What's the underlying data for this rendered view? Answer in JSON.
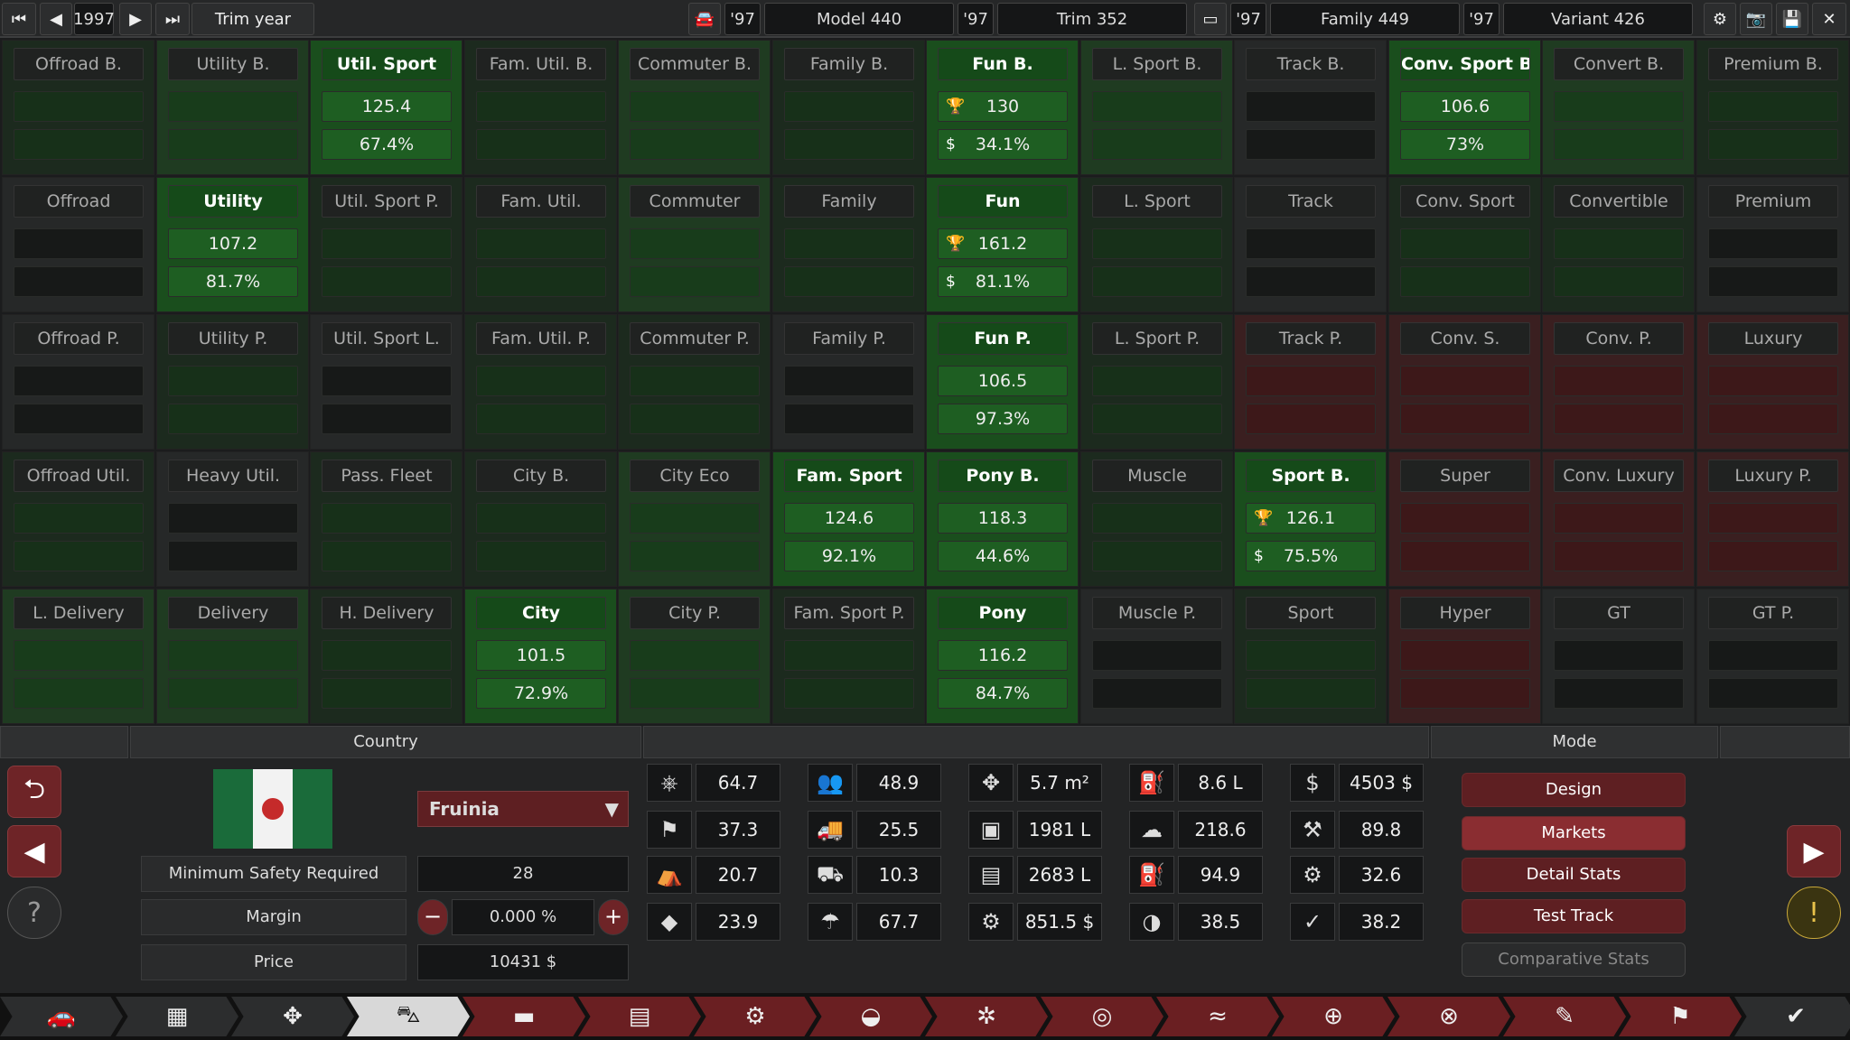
{
  "topbar": {
    "year": "1997",
    "trim_year_label": "Trim year",
    "model_year": "'97",
    "model_label": "Model 440",
    "trim_year": "'97",
    "trim_label": "Trim 352",
    "family_year": "'97",
    "family_label": "Family 449",
    "variant_year": "'97",
    "variant_label": "Variant 426"
  },
  "market_grid": [
    [
      {
        "label": "Offroad B.",
        "v1": "",
        "v2": "",
        "tone": "g0"
      },
      {
        "label": "Utility B.",
        "v1": "",
        "v2": "",
        "tone": "g1"
      },
      {
        "label": "Util. Sport",
        "v1": "125.4",
        "v2": "67.4%",
        "tone": "g2"
      },
      {
        "label": "Fam. Util. B.",
        "v1": "",
        "v2": "",
        "tone": "g0"
      },
      {
        "label": "Commuter B.",
        "v1": "",
        "v2": "",
        "tone": "g1"
      },
      {
        "label": "Family B.",
        "v1": "",
        "v2": "",
        "tone": "g0"
      },
      {
        "label": "Fun B.",
        "v1": "130",
        "v2": "34.1%",
        "tone": "g2",
        "icons": true
      },
      {
        "label": "L. Sport B.",
        "v1": "",
        "v2": "",
        "tone": "g1"
      },
      {
        "label": "Track B.",
        "v1": "",
        "v2": "",
        "tone": "n"
      },
      {
        "label": "Conv. Sport B.",
        "v1": "106.6",
        "v2": "73%",
        "tone": "g2"
      },
      {
        "label": "Convert B.",
        "v1": "",
        "v2": "",
        "tone": "g1"
      },
      {
        "label": "Premium B.",
        "v1": "",
        "v2": "",
        "tone": "g0"
      }
    ],
    [
      {
        "label": "Offroad",
        "v1": "",
        "v2": "",
        "tone": "n"
      },
      {
        "label": "Utility",
        "v1": "107.2",
        "v2": "81.7%",
        "tone": "g2"
      },
      {
        "label": "Util. Sport P.",
        "v1": "",
        "v2": "",
        "tone": "g0"
      },
      {
        "label": "Fam. Util.",
        "v1": "",
        "v2": "",
        "tone": "g0"
      },
      {
        "label": "Commuter",
        "v1": "",
        "v2": "",
        "tone": "g1"
      },
      {
        "label": "Family",
        "v1": "",
        "v2": "",
        "tone": "g0"
      },
      {
        "label": "Fun",
        "v1": "161.2",
        "v2": "81.1%",
        "tone": "g2",
        "icons": true
      },
      {
        "label": "L. Sport",
        "v1": "",
        "v2": "",
        "tone": "g0"
      },
      {
        "label": "Track",
        "v1": "",
        "v2": "",
        "tone": "n"
      },
      {
        "label": "Conv. Sport",
        "v1": "",
        "v2": "",
        "tone": "g0"
      },
      {
        "label": "Convertible",
        "v1": "",
        "v2": "",
        "tone": "g0"
      },
      {
        "label": "Premium",
        "v1": "",
        "v2": "",
        "tone": "n"
      }
    ],
    [
      {
        "label": "Offroad P.",
        "v1": "",
        "v2": "",
        "tone": "n"
      },
      {
        "label": "Utility P.",
        "v1": "",
        "v2": "",
        "tone": "g0"
      },
      {
        "label": "Util. Sport L.",
        "v1": "",
        "v2": "",
        "tone": "n"
      },
      {
        "label": "Fam. Util. P.",
        "v1": "",
        "v2": "",
        "tone": "g0"
      },
      {
        "label": "Commuter P.",
        "v1": "",
        "v2": "",
        "tone": "g0"
      },
      {
        "label": "Family P.",
        "v1": "",
        "v2": "",
        "tone": "n"
      },
      {
        "label": "Fun P.",
        "v1": "106.5",
        "v2": "97.3%",
        "tone": "g2"
      },
      {
        "label": "L. Sport P.",
        "v1": "",
        "v2": "",
        "tone": "g0"
      },
      {
        "label": "Track P.",
        "v1": "",
        "v2": "",
        "tone": "r1"
      },
      {
        "label": "Conv. S.",
        "v1": "",
        "v2": "",
        "tone": "r1"
      },
      {
        "label": "Conv. P.",
        "v1": "",
        "v2": "",
        "tone": "r1"
      },
      {
        "label": "Luxury",
        "v1": "",
        "v2": "",
        "tone": "r1"
      }
    ],
    [
      {
        "label": "Offroad Util.",
        "v1": "",
        "v2": "",
        "tone": "g0"
      },
      {
        "label": "Heavy Util.",
        "v1": "",
        "v2": "",
        "tone": "n"
      },
      {
        "label": "Pass. Fleet",
        "v1": "",
        "v2": "",
        "tone": "g0"
      },
      {
        "label": "City B.",
        "v1": "",
        "v2": "",
        "tone": "g0"
      },
      {
        "label": "City Eco",
        "v1": "",
        "v2": "",
        "tone": "g1"
      },
      {
        "label": "Fam. Sport",
        "v1": "124.6",
        "v2": "92.1%",
        "tone": "g2"
      },
      {
        "label": "Pony B.",
        "v1": "118.3",
        "v2": "44.6%",
        "tone": "g2"
      },
      {
        "label": "Muscle",
        "v1": "",
        "v2": "",
        "tone": "g0"
      },
      {
        "label": "Sport B.",
        "v1": "126.1",
        "v2": "75.5%",
        "tone": "g2",
        "icons": true
      },
      {
        "label": "Super",
        "v1": "",
        "v2": "",
        "tone": "r1"
      },
      {
        "label": "Conv. Luxury",
        "v1": "",
        "v2": "",
        "tone": "r1"
      },
      {
        "label": "Luxury P.",
        "v1": "",
        "v2": "",
        "tone": "r1"
      }
    ],
    [
      {
        "label": "L. Delivery",
        "v1": "",
        "v2": "",
        "tone": "g1"
      },
      {
        "label": "Delivery",
        "v1": "",
        "v2": "",
        "tone": "g1"
      },
      {
        "label": "H. Delivery",
        "v1": "",
        "v2": "",
        "tone": "g0"
      },
      {
        "label": "City",
        "v1": "101.5",
        "v2": "72.9%",
        "tone": "g2"
      },
      {
        "label": "City P.",
        "v1": "",
        "v2": "",
        "tone": "g1"
      },
      {
        "label": "Fam. Sport P.",
        "v1": "",
        "v2": "",
        "tone": "g0"
      },
      {
        "label": "Pony",
        "v1": "116.2",
        "v2": "84.7%",
        "tone": "g2"
      },
      {
        "label": "Muscle P.",
        "v1": "",
        "v2": "",
        "tone": "n"
      },
      {
        "label": "Sport",
        "v1": "",
        "v2": "",
        "tone": "g0"
      },
      {
        "label": "Hyper",
        "v1": "",
        "v2": "",
        "tone": "r1"
      },
      {
        "label": "GT",
        "v1": "",
        "v2": "",
        "tone": "n"
      },
      {
        "label": "GT P.",
        "v1": "",
        "v2": "",
        "tone": "n"
      }
    ]
  ],
  "country": {
    "header": "Country",
    "selected": "Fruinia",
    "min_safety_label": "Minimum Safety Required",
    "min_safety_value": "28",
    "margin_label": "Margin",
    "margin_value": "0.000 %",
    "price_label": "Price",
    "price_value": "10431 $"
  },
  "stats": [
    {
      "icon": "steering-wheel-icon",
      "glyph": "⎈",
      "value": "64.7"
    },
    {
      "icon": "passengers-icon",
      "glyph": "👥",
      "value": "48.9"
    },
    {
      "icon": "dimensions-icon",
      "glyph": "✥",
      "value": "5.7 m²"
    },
    {
      "icon": "fuel-tank-icon",
      "glyph": "⛽",
      "value": "8.6 L"
    },
    {
      "icon": "cost-icon",
      "glyph": "$",
      "value": "4503 $"
    },
    {
      "icon": "race-flag-icon",
      "glyph": "⚑",
      "value": "37.3"
    },
    {
      "icon": "utility-vehicle-icon",
      "glyph": "🚚",
      "value": "25.5"
    },
    {
      "icon": "cargo-volume-icon",
      "glyph": "▣",
      "value": "1981 L"
    },
    {
      "icon": "emissions-icon",
      "glyph": "☁",
      "value": "218.6"
    },
    {
      "icon": "workload-icon",
      "glyph": "⚒",
      "value": "89.8"
    },
    {
      "icon": "comfort-seat-icon",
      "glyph": "⛺",
      "value": "20.7"
    },
    {
      "icon": "offroad-icon",
      "glyph": "⛟",
      "value": "10.3"
    },
    {
      "icon": "passenger-volume-icon",
      "glyph": "▤",
      "value": "2683 L"
    },
    {
      "icon": "fuel-pump-icon",
      "glyph": "⛽",
      "value": "94.9 RON"
    },
    {
      "icon": "service-cost-icon",
      "glyph": "⚙",
      "value": "32.6"
    },
    {
      "icon": "prestige-diamond-icon",
      "glyph": "◆",
      "value": "23.9"
    },
    {
      "icon": "reliability-cloud-icon",
      "glyph": "☂",
      "value": "67.7"
    },
    {
      "icon": "running-cost-icon",
      "glyph": "⚙",
      "value": "851.5 $"
    },
    {
      "icon": "safety-crash-icon",
      "glyph": "◑",
      "value": "38.5"
    },
    {
      "icon": "environment-icon",
      "glyph": "✓",
      "value": "38.2"
    }
  ],
  "mode": {
    "header": "Mode",
    "buttons": [
      "Design",
      "Markets",
      "Detail Stats",
      "Test Track",
      "Comparative Stats"
    ]
  },
  "colors": {
    "accent_red": "#6e2427",
    "green_active": "#1a4e1d",
    "green_dim": "#1c2a1e"
  }
}
